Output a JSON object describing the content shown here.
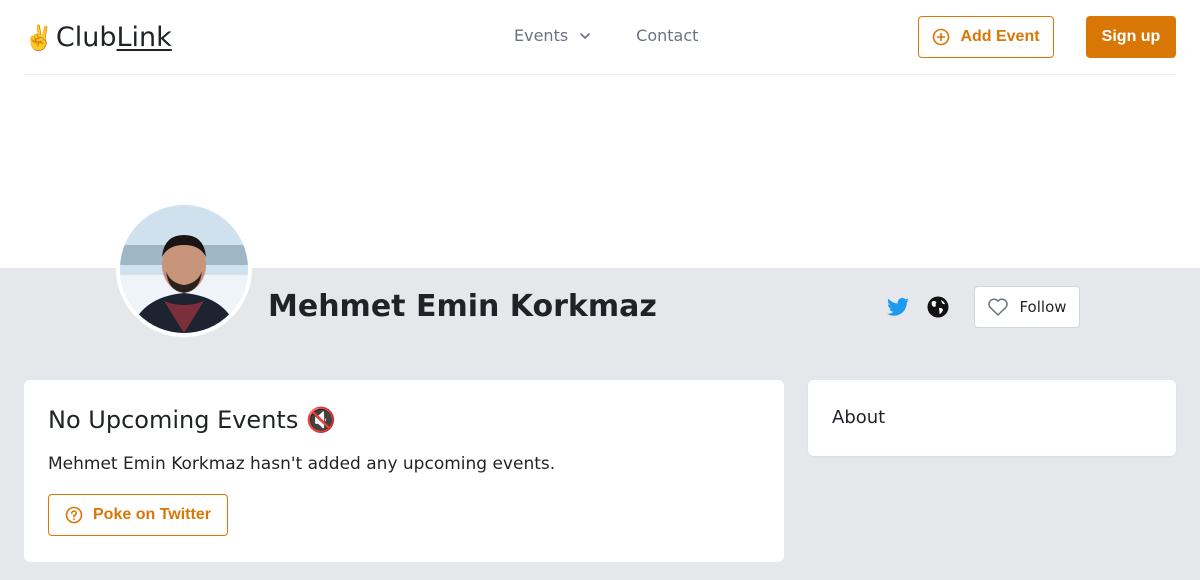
{
  "brand": {
    "emoji": "✌️",
    "name_part1": "Club",
    "name_part2": "Link"
  },
  "nav": {
    "events": "Events",
    "contact": "Contact"
  },
  "header": {
    "add_event": "Add Event",
    "sign_up": "Sign up"
  },
  "profile": {
    "name": "Mehmet Emin Korkmaz",
    "follow": "Follow"
  },
  "upcoming": {
    "title": "No Upcoming Events",
    "title_emoji": "🔇",
    "message": "Mehmet Emin Korkmaz hasn't added any upcoming events.",
    "poke": "Poke on Twitter"
  },
  "about": {
    "title": "About"
  },
  "colors": {
    "accent": "#d97706",
    "twitter": "#1d9bf0",
    "gray_bg": "#e5e7eb"
  }
}
